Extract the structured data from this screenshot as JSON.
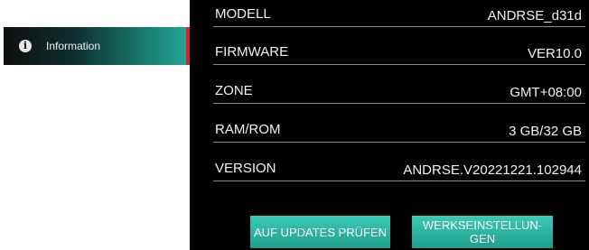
{
  "sidebar": {
    "items": [
      {
        "label": "Information",
        "icon": "info-icon"
      }
    ],
    "active_color": "#d0252b"
  },
  "info": {
    "rows": [
      {
        "key": "MODELL",
        "value": "ANDRSE_d31d"
      },
      {
        "key": "FIRMWARE",
        "value": "VER10.0"
      },
      {
        "key": "ZONE",
        "value": "GMT+08:00"
      },
      {
        "key": "RAM/ROM",
        "value": "3 GB/32 GB"
      },
      {
        "key": "VERSION",
        "value": "ANDRSE.V20221221.102944"
      }
    ]
  },
  "actions": {
    "check_updates_label": "AUF UPDATES PRÜFEN",
    "factory_reset_label": "WERKSEINSTELLUN-\nGEN",
    "accent_color": "#2db3a1"
  }
}
